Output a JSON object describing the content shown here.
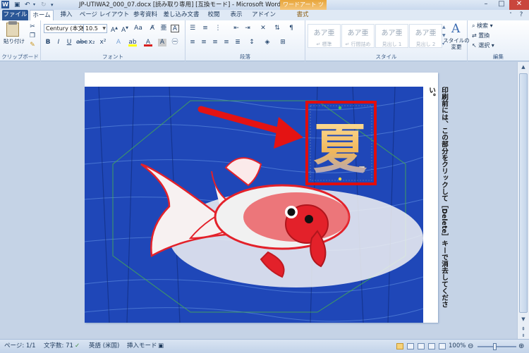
{
  "app": {
    "title": "JP-UTIWA2_000_07.docx [読み取り専用] [互換モード] - Microsoft Word",
    "context_tab_header": "ワードアート ツール"
  },
  "tabs": [
    {
      "label": "ファイル"
    },
    {
      "label": "ホーム"
    },
    {
      "label": "挿入"
    },
    {
      "label": "ページ レイアウト"
    },
    {
      "label": "参考資料"
    },
    {
      "label": "差し込み文書"
    },
    {
      "label": "校閲"
    },
    {
      "label": "表示"
    },
    {
      "label": "アドイン"
    },
    {
      "label": "書式"
    }
  ],
  "ribbon": {
    "clipboard": {
      "paste_label": "貼り付け",
      "group_label": "クリップボード"
    },
    "font": {
      "font_name": "Century (本文",
      "font_size": "10.5",
      "group_label": "フォント",
      "font_color": "#d81f1f",
      "highlight_color": "#ffff00"
    },
    "paragraph": {
      "group_label": "段落"
    },
    "styles": {
      "tiles": [
        {
          "sample": "あア亜",
          "name": "↵ 標準"
        },
        {
          "sample": "あア亜",
          "name": "↵ 行間詰め"
        },
        {
          "sample": "あア亜",
          "name": "見出し 1"
        },
        {
          "sample": "あア亜",
          "name": "見出し 2"
        }
      ],
      "change_styles_label": "スタイルの変更",
      "group_label": "スタイル"
    },
    "editing": {
      "find_label": "検索",
      "replace_label": "置換",
      "select_label": "選択",
      "group_label": "編集"
    }
  },
  "document": {
    "wordart_text": "夏",
    "instruction_text": "印刷前には、この部分をクリックして［Delete］キーで消去してください。",
    "colors": {
      "background_blue": "#1f47b8",
      "fish_red": "#e3212a",
      "frame_red": "#e10d0d",
      "arrow_red": "#e41313"
    }
  },
  "status": {
    "page": "ページ: 1/1",
    "word_count": "文字数: 71",
    "language": "英語 (米国)",
    "insert_mode": "挿入モード",
    "zoom": "100%"
  }
}
